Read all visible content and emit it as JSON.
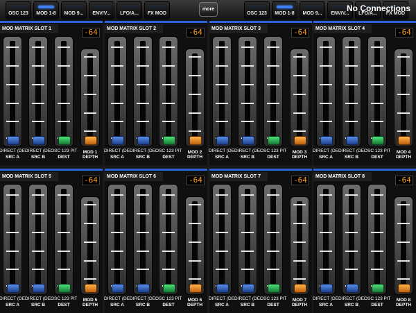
{
  "top_bar": {
    "tabs_left": [
      {
        "label": "OSC 123",
        "active": false
      },
      {
        "label": "MOD 1-8",
        "active": true
      },
      {
        "label": "MOD 9...",
        "active": false
      },
      {
        "label": "ENV/V...",
        "active": false
      },
      {
        "label": "LFO/A...",
        "active": false
      },
      {
        "label": "FX MOD",
        "active": false
      }
    ],
    "more_label": "more",
    "tabs_right": [
      {
        "label": "OSC 123",
        "active": false
      },
      {
        "label": "MOD 1-8",
        "active": true
      },
      {
        "label": "MOD 9...",
        "active": false
      },
      {
        "label": "ENV/V...",
        "active": false
      },
      {
        "label": "LFO/A...",
        "active": false
      },
      {
        "label": "FX MOD",
        "active": false
      }
    ],
    "connection_status": "No Connections"
  },
  "colors": {
    "accent_blue": "#2a64d8",
    "display_orange": "#ff9a1f",
    "thumb_green": "#2fc95a"
  },
  "slots": [
    {
      "title": "MOD MATRIX SLOT 1",
      "depth_value": "-64",
      "src_a_value": "DIRECT (DEF",
      "src_b_value": "DIRECT (DEF",
      "dest_value": "OSC 123 PIT",
      "labels": [
        "SRC A",
        "SRC B",
        "DEST",
        "MOD 1 DEPTH"
      ]
    },
    {
      "title": "MOD MATRIX SLOT 2",
      "depth_value": "-64",
      "src_a_value": "DIRECT (DEF",
      "src_b_value": "DIRECT (DEF",
      "dest_value": "OSC 123 PIT",
      "labels": [
        "SRC A",
        "SRC B",
        "DEST",
        "MOD 2 DEPTH"
      ]
    },
    {
      "title": "MOD MATRIX SLOT 3",
      "depth_value": "-64",
      "src_a_value": "DIRECT (DEF",
      "src_b_value": "DIRECT (DEF",
      "dest_value": "OSC 123 PIT",
      "labels": [
        "SRC A",
        "SRC B",
        "DEST",
        "MOD 3 DEPTH"
      ]
    },
    {
      "title": "MOD MATRIX SLOT 4",
      "depth_value": "-64",
      "src_a_value": "DIRECT (DEF",
      "src_b_value": "DIRECT (DEF",
      "dest_value": "OSC 123 PIT",
      "labels": [
        "SRC A",
        "SRC B",
        "DEST",
        "MOD 4 DEPTH"
      ]
    },
    {
      "title": "MOD MATRIX SLOT 5",
      "depth_value": "-64",
      "src_a_value": "DIRECT (DEF",
      "src_b_value": "DIRECT (DEF",
      "dest_value": "OSC 123 PIT",
      "labels": [
        "SRC A",
        "SRC B",
        "DEST",
        "MOD 5 DEPTH"
      ]
    },
    {
      "title": "MOD MATRIX SLOT 6",
      "depth_value": "-64",
      "src_a_value": "DIRECT (DEF",
      "src_b_value": "DIRECT (DEF",
      "dest_value": "OSC 123 PIT",
      "labels": [
        "SRC A",
        "SRC B",
        "DEST",
        "MOD 6 DEPTH"
      ]
    },
    {
      "title": "MOD MATRIX SLOT 7",
      "depth_value": "-64",
      "src_a_value": "DIRECT (DEF",
      "src_b_value": "DIRECT (DEF",
      "dest_value": "OSC 123 PIT",
      "labels": [
        "SRC A",
        "SRC B",
        "DEST",
        "MOD 7 DEPTH"
      ]
    },
    {
      "title": "MOD MATRIX SLOT 8",
      "depth_value": "-64",
      "src_a_value": "DIRECT (DEF",
      "src_b_value": "DIRECT (DEF",
      "dest_value": "OSC 123 PIT",
      "labels": [
        "SRC A",
        "SRC B",
        "DEST",
        "MOD 8 DEPTH"
      ]
    }
  ]
}
